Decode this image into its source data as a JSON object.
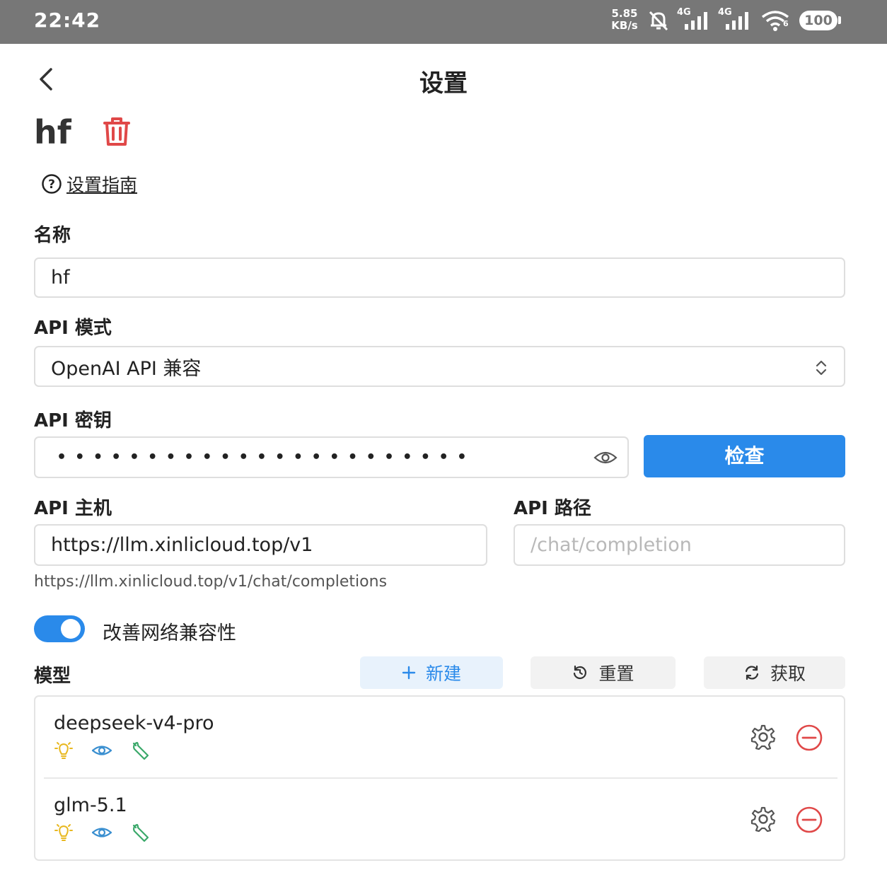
{
  "status_bar": {
    "time": "22:42",
    "speed_value": "5.85",
    "speed_unit": "KB/s",
    "sim1_label": "4G",
    "sim2_label": "4G",
    "wifi_label": "6",
    "battery": "100"
  },
  "header": {
    "title": "设置"
  },
  "provider": {
    "name": "hf",
    "guide_link": "设置指南"
  },
  "form": {
    "name_label": "名称",
    "name_value": "hf",
    "api_mode_label": "API 模式",
    "api_mode_value": "OpenAI API 兼容",
    "api_key_label": "API 密钥",
    "api_key_masked": "• • • • • • • • • • • • • • • • • • • • • • •",
    "check_button": "检查",
    "api_host_label": "API 主机",
    "api_host_value": "https://llm.xinlicloud.top/v1",
    "api_path_label": "API 路径",
    "api_path_placeholder": "/chat/completion",
    "resolved_url": "https://llm.xinlicloud.top/v1/chat/completions",
    "network_compat_label": "改善网络兼容性",
    "network_compat_enabled": true
  },
  "models": {
    "label": "模型",
    "new_button": "新建",
    "reset_button": "重置",
    "fetch_button": "获取",
    "items": [
      {
        "name": "deepseek-v4-pro",
        "capabilities": [
          "reasoning-bulb-icon",
          "vision-eye-icon",
          "tool-wrench-icon"
        ]
      },
      {
        "name": "glm-5.1",
        "capabilities": [
          "reasoning-bulb-icon",
          "vision-eye-icon",
          "tool-wrench-icon"
        ]
      }
    ]
  },
  "colors": {
    "accent": "#2a8aea",
    "danger": "#e04848",
    "bulb": "#e8b820",
    "eye": "#3a8fd0",
    "wrench": "#3aa86a",
    "status_bar": "#777777"
  }
}
